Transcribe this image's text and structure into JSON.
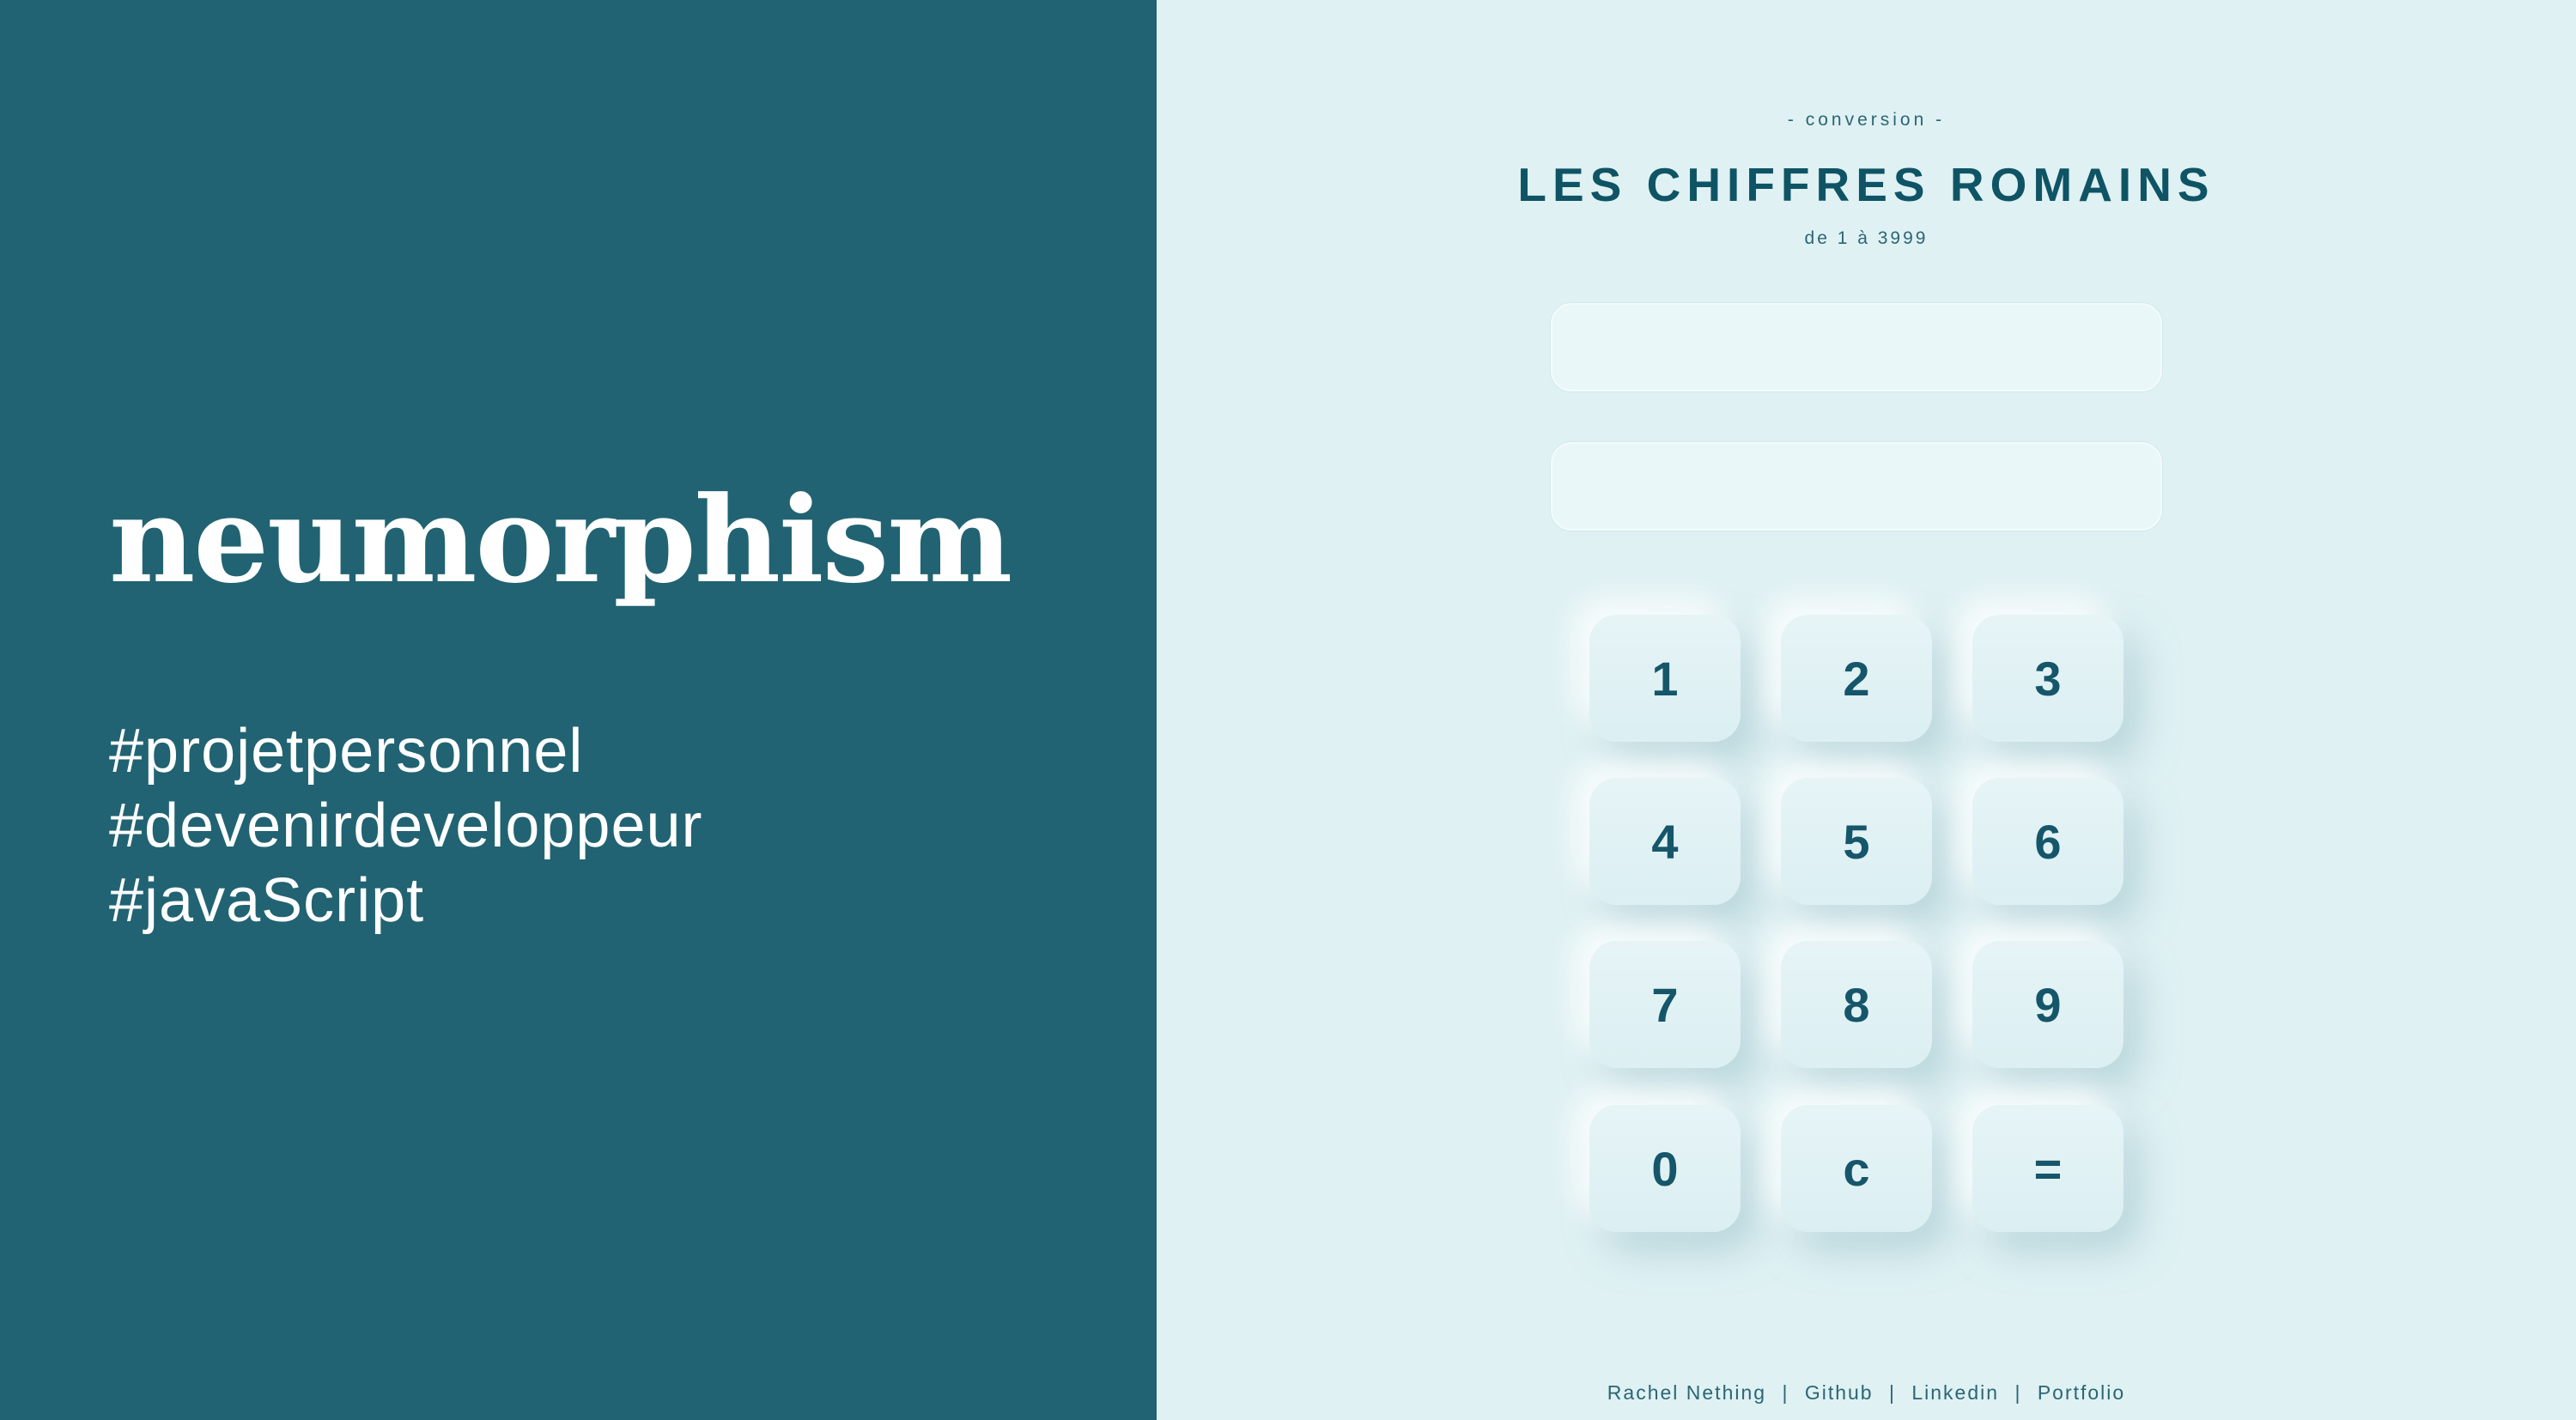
{
  "left_panel": {
    "brand": "neumorphism",
    "tags": [
      "#projetpersonnel",
      "#devenirdeveloppeur",
      "#javaScript"
    ],
    "background_color": "#216372"
  },
  "app": {
    "kicker": "- conversion -",
    "title": "LES CHIFFRES ROMAINS",
    "subtitle": "de 1 à 3999",
    "background_color": "#dff1f3",
    "inputs": [
      {
        "value": "",
        "placeholder": ""
      },
      {
        "value": "",
        "placeholder": ""
      }
    ],
    "keypad": {
      "keys": [
        "1",
        "2",
        "3",
        "4",
        "5",
        "6",
        "7",
        "8",
        "9",
        "0",
        "c",
        "="
      ]
    },
    "footer": {
      "author": "Rachel Nething",
      "links": [
        "Github",
        "Linkedin",
        "Portfolio"
      ],
      "separator": "|"
    }
  }
}
